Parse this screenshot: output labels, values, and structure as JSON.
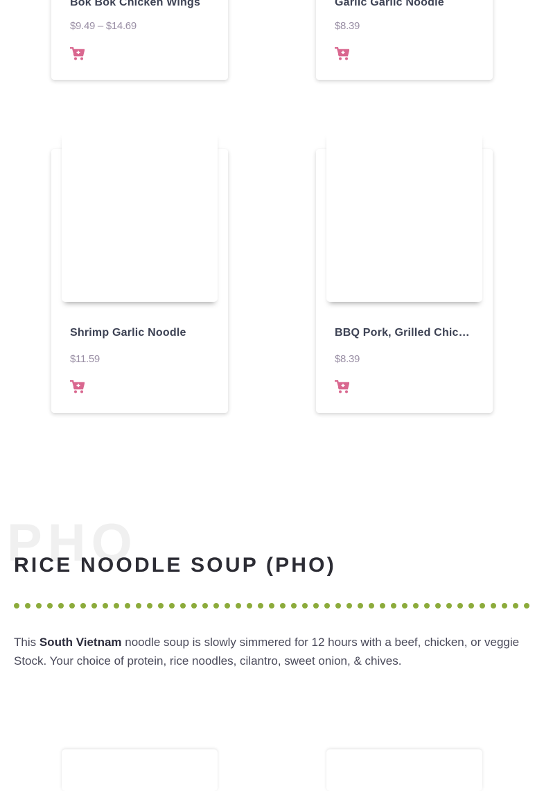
{
  "products_top": [
    {
      "name": "Bok Bok Chicken Wings",
      "price": "$9.49 – $14.69"
    },
    {
      "name": "Garlic Garlic Noodle",
      "price": "$8.39"
    }
  ],
  "products_mid": [
    {
      "name": "Shrimp Garlic Noodle",
      "price": "$11.59"
    },
    {
      "name": "BBQ Pork, Grilled Chicken",
      "price": "$8.39"
    }
  ],
  "section": {
    "ghost_text": "PHO",
    "title": "RICE NOODLE SOUP (PHO)",
    "desc_pre": "This ",
    "desc_bold": "South Vietnam",
    "desc_post": " noodle soup is slowly simmered for 12 hours with a beef, chicken, or veggie Stock. Your choice of protein, rice noodles, cilantro, sweet onion, & chives."
  },
  "icons": {
    "cart": "add-to-cart-icon"
  },
  "colors": {
    "cart": "#d9678f",
    "divider_dots": "#8cab3b"
  }
}
